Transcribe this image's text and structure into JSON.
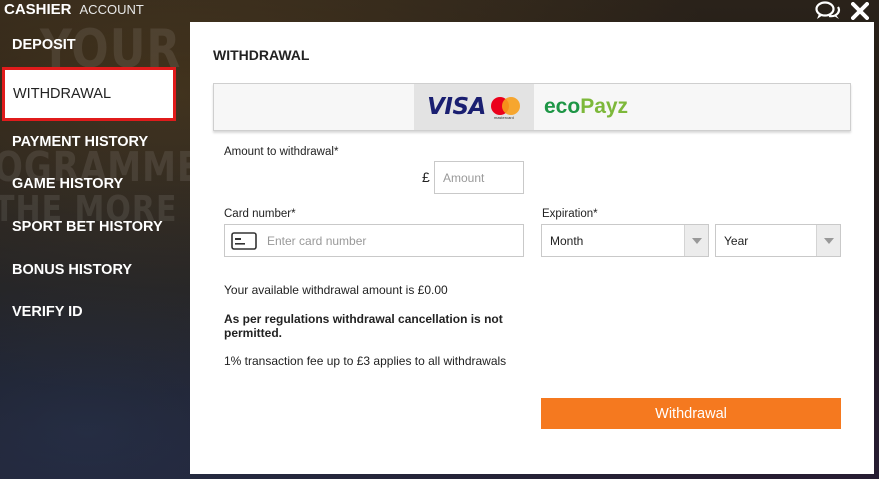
{
  "header": {
    "tab_cashier": "CASHIER",
    "tab_account": "ACCOUNT"
  },
  "background_text": {
    "line1": "YOUR",
    "line2": "OGRAMME WHI",
    "line3": "THE MORE REWA"
  },
  "sidebar": {
    "items": [
      {
        "label": "DEPOSIT"
      },
      {
        "label": "WITHDRAWAL"
      },
      {
        "label": "PAYMENT HISTORY"
      },
      {
        "label": "GAME HISTORY"
      },
      {
        "label": "SPORT BET HISTORY"
      },
      {
        "label": "BONUS HISTORY"
      },
      {
        "label": "VERIFY ID"
      }
    ]
  },
  "panel": {
    "title": "WITHDRAWAL",
    "methods": {
      "visa": "VISA",
      "mastercard": "mastercard",
      "ecopayz_eco": "eco",
      "ecopayz_payz": "Payz"
    },
    "amount": {
      "label": "Amount to withdrawal*",
      "currency": "£",
      "placeholder": "Amount"
    },
    "card": {
      "label": "Card number*",
      "placeholder": "Enter card number"
    },
    "expiration": {
      "label": "Expiration*",
      "month": "Month",
      "year": "Year"
    },
    "available": "Your available withdrawal amount is £0.00",
    "regulation": "As per regulations withdrawal cancellation is not permitted.",
    "fee": "1% transaction fee up to £3 applies to all withdrawals",
    "button": "Withdrawal"
  },
  "colors": {
    "accent": "#f5791f",
    "active_border": "#e01b1b"
  },
  "icons": [
    "chat-icon",
    "close-icon",
    "card-icon",
    "dropdown-arrow-icon"
  ]
}
